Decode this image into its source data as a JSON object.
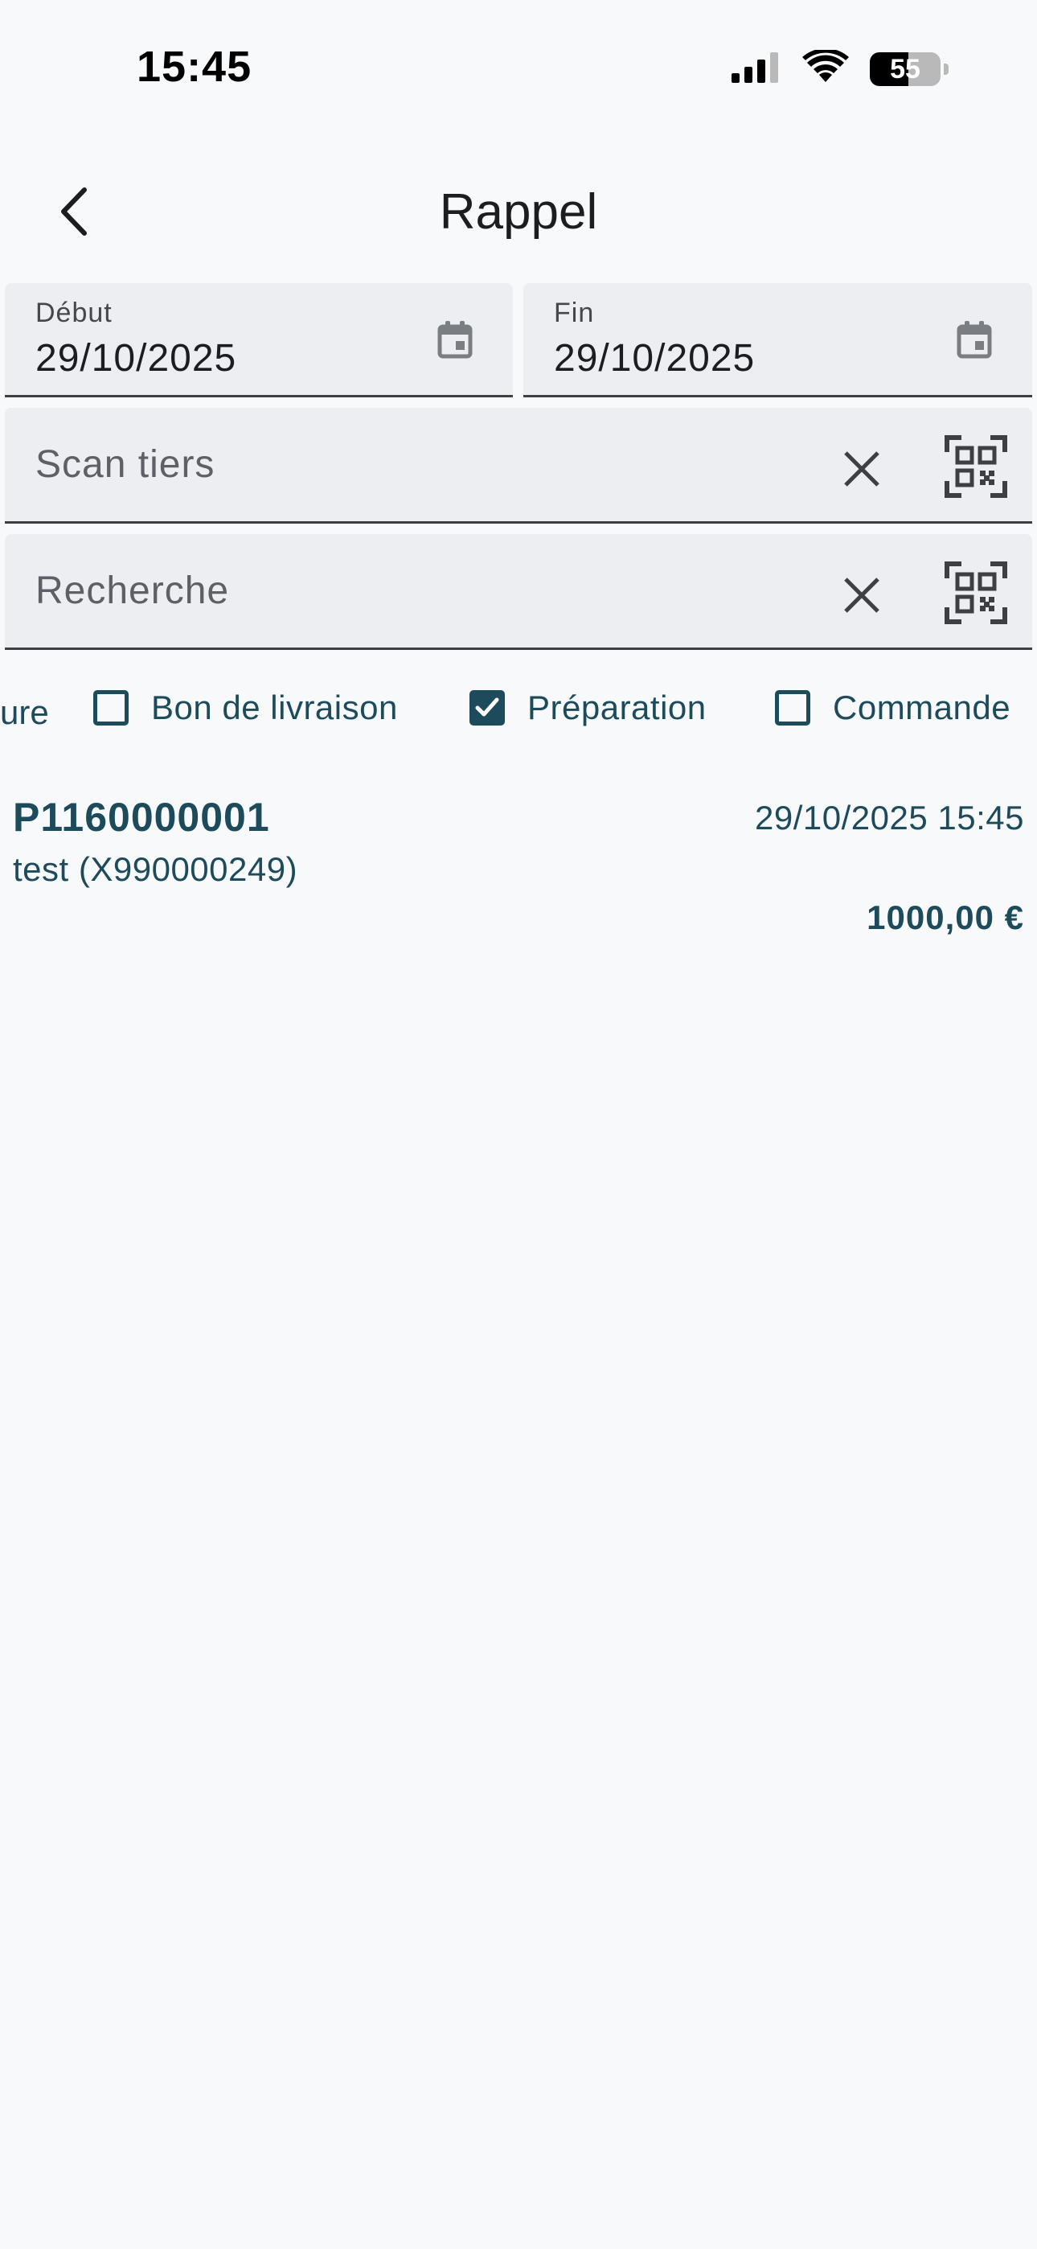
{
  "status_bar": {
    "time": "15:45",
    "battery_level": "55",
    "icons": [
      "signal-icon",
      "wifi-icon",
      "battery-icon"
    ]
  },
  "app_bar": {
    "title": "Rappel",
    "back_icon": "chevron-left-icon"
  },
  "date_range": {
    "start": {
      "label": "Début",
      "value": "29/10/2025",
      "icon": "calendar-icon"
    },
    "end": {
      "label": "Fin",
      "value": "29/10/2025",
      "icon": "calendar-icon"
    }
  },
  "scan_field": {
    "placeholder": "Scan tiers",
    "value": "",
    "clear_icon": "close-icon",
    "scan_icon": "qr-code-scan-icon"
  },
  "search_field": {
    "placeholder": "Recherche",
    "value": "",
    "clear_icon": "close-icon",
    "scan_icon": "qr-code-scan-icon"
  },
  "filters": {
    "partial_label": "ure",
    "items": [
      {
        "label": "Bon de livraison",
        "checked": false
      },
      {
        "label": "Préparation",
        "checked": true
      },
      {
        "label": "Commande",
        "checked": false
      }
    ]
  },
  "results": [
    {
      "code": "P1160000001",
      "date": "29/10/2025 15:45",
      "client": "test (X990000249)",
      "amount": "1000,00 €"
    }
  ],
  "colors": {
    "background": "#f7f9fb",
    "field_background": "#edeef1",
    "accent": "#1e4b5b"
  }
}
